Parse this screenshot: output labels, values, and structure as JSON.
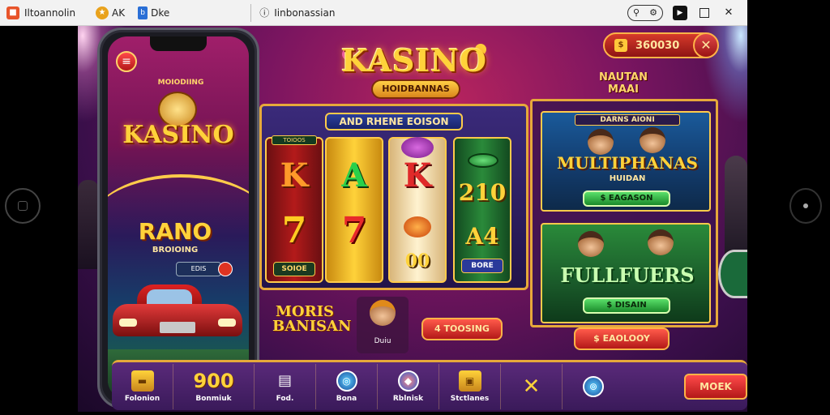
{
  "window": {
    "app_title": "Iltoannolin",
    "tab1_label": "AK",
    "tab2_label": "Dke",
    "url_text": "Iinbonassian"
  },
  "header": {
    "logo_title": "KASINO",
    "logo_subtitle": "HOIDBANNAS",
    "balance": "360030",
    "promo_text": "NAUTAN MAAI"
  },
  "phone": {
    "subtitle": "MOIODIING",
    "logo": "KASINO",
    "feature_title": "RANO",
    "feature_subtitle": "BROIOING",
    "badge_text": "EDIS"
  },
  "slot": {
    "title": "AND RHENE EOISON",
    "reel1_tag_top": "TOIOOS",
    "reel1_symbols": [
      "K",
      "7"
    ],
    "reel1_tag": "SOIOE",
    "reel2_symbols": [
      "A",
      "7"
    ],
    "reel3_symbols": [
      "K",
      "00"
    ],
    "reel4_symbols": [
      "210",
      "A4"
    ],
    "reel4_tag": "BORE"
  },
  "mid_row": {
    "logo_text": "MORIS BANISAN",
    "character_label": "Duiu",
    "button_label": "4 TOOSING"
  },
  "right_panel": {
    "card1_head": "DARNS AIONI",
    "card1_title": "MULTIPHANAS",
    "card1_sub": "HUIDAN",
    "card1_button": "$ EAGASON",
    "card2_title": "FULLFUERS",
    "card2_button": "$ DISAIN",
    "bottom_button": "$ EAOLOOY"
  },
  "bottom_bar": {
    "items": [
      {
        "icon": "gold-bars-icon",
        "label": "Folonion"
      },
      {
        "number": "900",
        "label": "Bonmiuk"
      },
      {
        "icon": "document-icon",
        "label": "Fod."
      },
      {
        "icon": "globe-icon",
        "label": "Bona"
      },
      {
        "icon": "shield-icon",
        "label": "Rblnisk"
      },
      {
        "icon": "treasure-icon",
        "label": "Stctlanes"
      },
      {
        "icon": "close-icon",
        "label": ""
      },
      {
        "icon": "target-icon",
        "label": ""
      }
    ],
    "main_button": "MOEK"
  },
  "colors": {
    "accent_gold": "#ffd23a",
    "border_gold": "#e6a93a",
    "button_red": "#b31818",
    "button_green": "#1a8a2a",
    "background_magenta": "#7a1560"
  }
}
